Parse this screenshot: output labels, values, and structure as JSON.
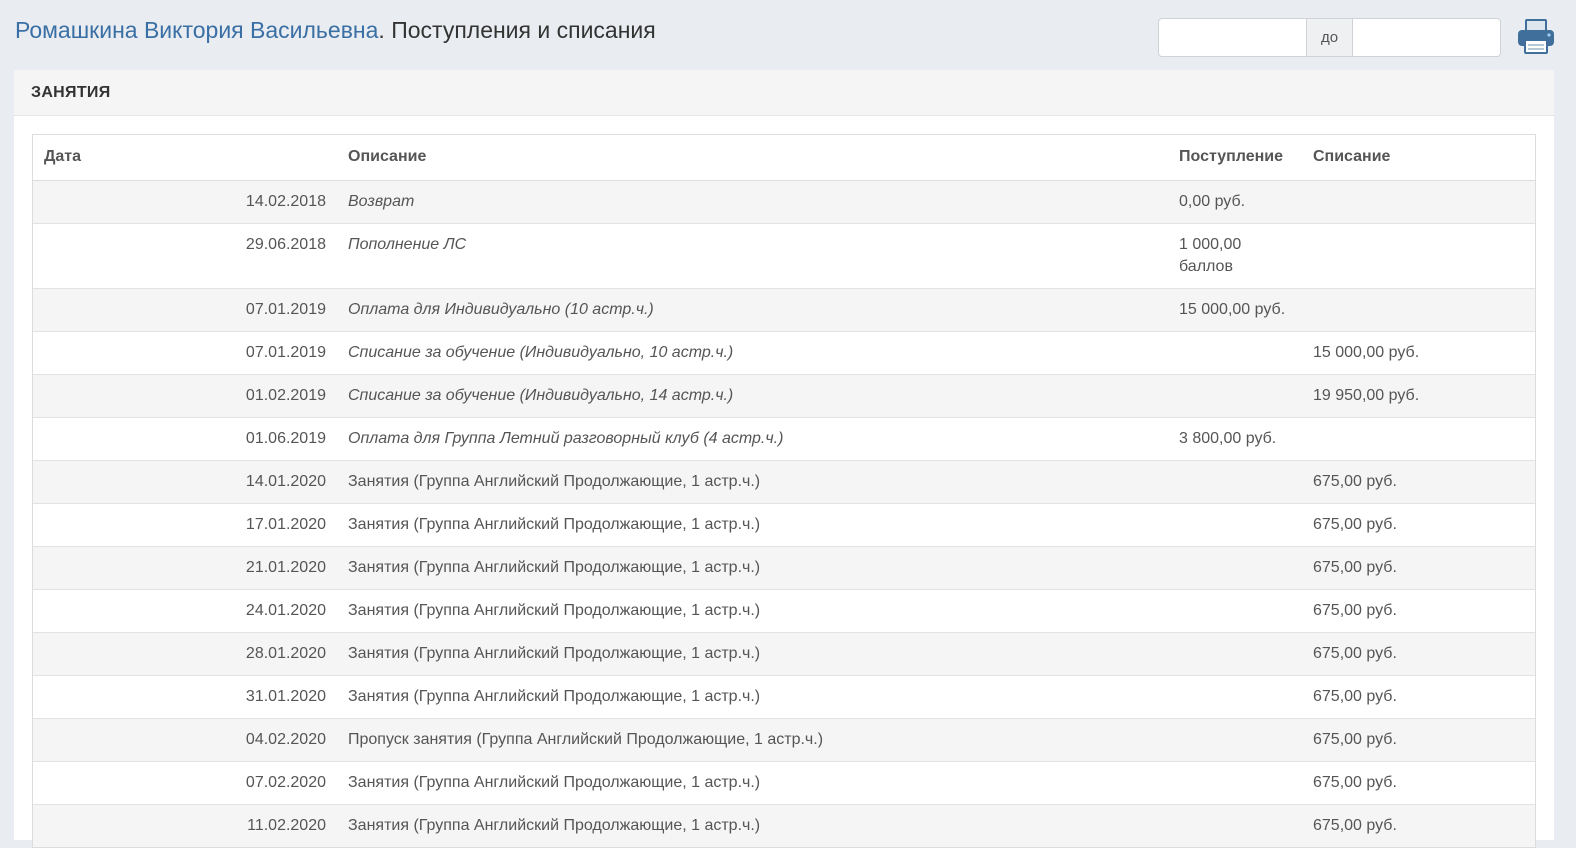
{
  "header": {
    "student_name": "Ромашкина Виктория Васильевна",
    "title_suffix": ". Поступления и списания",
    "date_from_value": "",
    "date_separator": "до",
    "date_to_value": "",
    "print_icon": "printer-icon"
  },
  "panel": {
    "heading": "ЗАНЯТИЯ"
  },
  "table": {
    "columns": [
      "Дата",
      "Описание",
      "Поступление",
      "Списание"
    ],
    "rows": [
      {
        "date": "14.02.2018",
        "description": "Возврат",
        "italic": true,
        "income": "0,00 руб.",
        "expense": ""
      },
      {
        "date": "29.06.2018",
        "description": "Пополнение ЛС",
        "italic": true,
        "income": "1 000,00\nбаллов",
        "expense": ""
      },
      {
        "date": "07.01.2019",
        "description": "Оплата для Индивидуально (10 астр.ч.)",
        "italic": true,
        "income": "15 000,00 руб.",
        "expense": ""
      },
      {
        "date": "07.01.2019",
        "description": "Списание за обучение (Индивидуально, 10 астр.ч.)",
        "italic": true,
        "income": "",
        "expense": "15 000,00 руб."
      },
      {
        "date": "01.02.2019",
        "description": "Списание за обучение (Индивидуально, 14 астр.ч.)",
        "italic": true,
        "income": "",
        "expense": "19 950,00 руб."
      },
      {
        "date": "01.06.2019",
        "description": "Оплата для Группа Летний разговорный клуб (4 астр.ч.)",
        "italic": true,
        "income": "3 800,00 руб.",
        "expense": ""
      },
      {
        "date": "14.01.2020",
        "description": "Занятия (Группа Английский Продолжающие, 1 астр.ч.)",
        "italic": false,
        "income": "",
        "expense": "675,00 руб."
      },
      {
        "date": "17.01.2020",
        "description": "Занятия (Группа Английский Продолжающие, 1 астр.ч.)",
        "italic": false,
        "income": "",
        "expense": "675,00 руб."
      },
      {
        "date": "21.01.2020",
        "description": "Занятия (Группа Английский Продолжающие, 1 астр.ч.)",
        "italic": false,
        "income": "",
        "expense": "675,00 руб."
      },
      {
        "date": "24.01.2020",
        "description": "Занятия (Группа Английский Продолжающие, 1 астр.ч.)",
        "italic": false,
        "income": "",
        "expense": "675,00 руб."
      },
      {
        "date": "28.01.2020",
        "description": "Занятия (Группа Английский Продолжающие, 1 астр.ч.)",
        "italic": false,
        "income": "",
        "expense": "675,00 руб."
      },
      {
        "date": "31.01.2020",
        "description": "Занятия (Группа Английский Продолжающие, 1 астр.ч.)",
        "italic": false,
        "income": "",
        "expense": "675,00 руб."
      },
      {
        "date": "04.02.2020",
        "description": "Пропуск занятия (Группа Английский Продолжающие, 1 астр.ч.)",
        "italic": false,
        "income": "",
        "expense": "675,00 руб."
      },
      {
        "date": "07.02.2020",
        "description": "Занятия (Группа Английский Продолжающие, 1 астр.ч.)",
        "italic": false,
        "income": "",
        "expense": "675,00 руб."
      },
      {
        "date": "11.02.2020",
        "description": "Занятия (Группа Английский Продолжающие, 1 астр.ч.)",
        "italic": false,
        "income": "",
        "expense": "675,00 руб."
      }
    ]
  },
  "colors": {
    "link": "#3a6fa5",
    "background": "#e9ecf0",
    "print_icon": "#3f6f9a"
  }
}
